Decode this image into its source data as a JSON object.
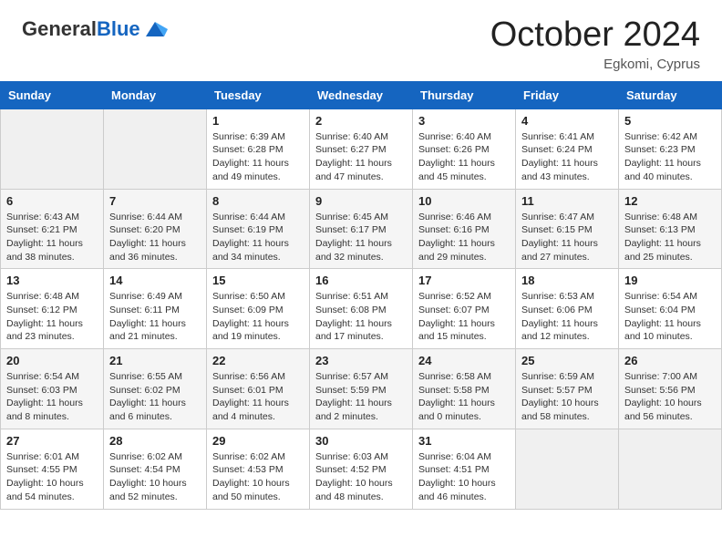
{
  "header": {
    "logo_general": "General",
    "logo_blue": "Blue",
    "month": "October 2024",
    "location": "Egkomi, Cyprus"
  },
  "weekdays": [
    "Sunday",
    "Monday",
    "Tuesday",
    "Wednesday",
    "Thursday",
    "Friday",
    "Saturday"
  ],
  "weeks": [
    [
      {
        "day": "",
        "content": ""
      },
      {
        "day": "",
        "content": ""
      },
      {
        "day": "1",
        "content": "Sunrise: 6:39 AM\nSunset: 6:28 PM\nDaylight: 11 hours and 49 minutes."
      },
      {
        "day": "2",
        "content": "Sunrise: 6:40 AM\nSunset: 6:27 PM\nDaylight: 11 hours and 47 minutes."
      },
      {
        "day": "3",
        "content": "Sunrise: 6:40 AM\nSunset: 6:26 PM\nDaylight: 11 hours and 45 minutes."
      },
      {
        "day": "4",
        "content": "Sunrise: 6:41 AM\nSunset: 6:24 PM\nDaylight: 11 hours and 43 minutes."
      },
      {
        "day": "5",
        "content": "Sunrise: 6:42 AM\nSunset: 6:23 PM\nDaylight: 11 hours and 40 minutes."
      }
    ],
    [
      {
        "day": "6",
        "content": "Sunrise: 6:43 AM\nSunset: 6:21 PM\nDaylight: 11 hours and 38 minutes."
      },
      {
        "day": "7",
        "content": "Sunrise: 6:44 AM\nSunset: 6:20 PM\nDaylight: 11 hours and 36 minutes."
      },
      {
        "day": "8",
        "content": "Sunrise: 6:44 AM\nSunset: 6:19 PM\nDaylight: 11 hours and 34 minutes."
      },
      {
        "day": "9",
        "content": "Sunrise: 6:45 AM\nSunset: 6:17 PM\nDaylight: 11 hours and 32 minutes."
      },
      {
        "day": "10",
        "content": "Sunrise: 6:46 AM\nSunset: 6:16 PM\nDaylight: 11 hours and 29 minutes."
      },
      {
        "day": "11",
        "content": "Sunrise: 6:47 AM\nSunset: 6:15 PM\nDaylight: 11 hours and 27 minutes."
      },
      {
        "day": "12",
        "content": "Sunrise: 6:48 AM\nSunset: 6:13 PM\nDaylight: 11 hours and 25 minutes."
      }
    ],
    [
      {
        "day": "13",
        "content": "Sunrise: 6:48 AM\nSunset: 6:12 PM\nDaylight: 11 hours and 23 minutes."
      },
      {
        "day": "14",
        "content": "Sunrise: 6:49 AM\nSunset: 6:11 PM\nDaylight: 11 hours and 21 minutes."
      },
      {
        "day": "15",
        "content": "Sunrise: 6:50 AM\nSunset: 6:09 PM\nDaylight: 11 hours and 19 minutes."
      },
      {
        "day": "16",
        "content": "Sunrise: 6:51 AM\nSunset: 6:08 PM\nDaylight: 11 hours and 17 minutes."
      },
      {
        "day": "17",
        "content": "Sunrise: 6:52 AM\nSunset: 6:07 PM\nDaylight: 11 hours and 15 minutes."
      },
      {
        "day": "18",
        "content": "Sunrise: 6:53 AM\nSunset: 6:06 PM\nDaylight: 11 hours and 12 minutes."
      },
      {
        "day": "19",
        "content": "Sunrise: 6:54 AM\nSunset: 6:04 PM\nDaylight: 11 hours and 10 minutes."
      }
    ],
    [
      {
        "day": "20",
        "content": "Sunrise: 6:54 AM\nSunset: 6:03 PM\nDaylight: 11 hours and 8 minutes."
      },
      {
        "day": "21",
        "content": "Sunrise: 6:55 AM\nSunset: 6:02 PM\nDaylight: 11 hours and 6 minutes."
      },
      {
        "day": "22",
        "content": "Sunrise: 6:56 AM\nSunset: 6:01 PM\nDaylight: 11 hours and 4 minutes."
      },
      {
        "day": "23",
        "content": "Sunrise: 6:57 AM\nSunset: 5:59 PM\nDaylight: 11 hours and 2 minutes."
      },
      {
        "day": "24",
        "content": "Sunrise: 6:58 AM\nSunset: 5:58 PM\nDaylight: 11 hours and 0 minutes."
      },
      {
        "day": "25",
        "content": "Sunrise: 6:59 AM\nSunset: 5:57 PM\nDaylight: 10 hours and 58 minutes."
      },
      {
        "day": "26",
        "content": "Sunrise: 7:00 AM\nSunset: 5:56 PM\nDaylight: 10 hours and 56 minutes."
      }
    ],
    [
      {
        "day": "27",
        "content": "Sunrise: 6:01 AM\nSunset: 4:55 PM\nDaylight: 10 hours and 54 minutes."
      },
      {
        "day": "28",
        "content": "Sunrise: 6:02 AM\nSunset: 4:54 PM\nDaylight: 10 hours and 52 minutes."
      },
      {
        "day": "29",
        "content": "Sunrise: 6:02 AM\nSunset: 4:53 PM\nDaylight: 10 hours and 50 minutes."
      },
      {
        "day": "30",
        "content": "Sunrise: 6:03 AM\nSunset: 4:52 PM\nDaylight: 10 hours and 48 minutes."
      },
      {
        "day": "31",
        "content": "Sunrise: 6:04 AM\nSunset: 4:51 PM\nDaylight: 10 hours and 46 minutes."
      },
      {
        "day": "",
        "content": ""
      },
      {
        "day": "",
        "content": ""
      }
    ]
  ]
}
